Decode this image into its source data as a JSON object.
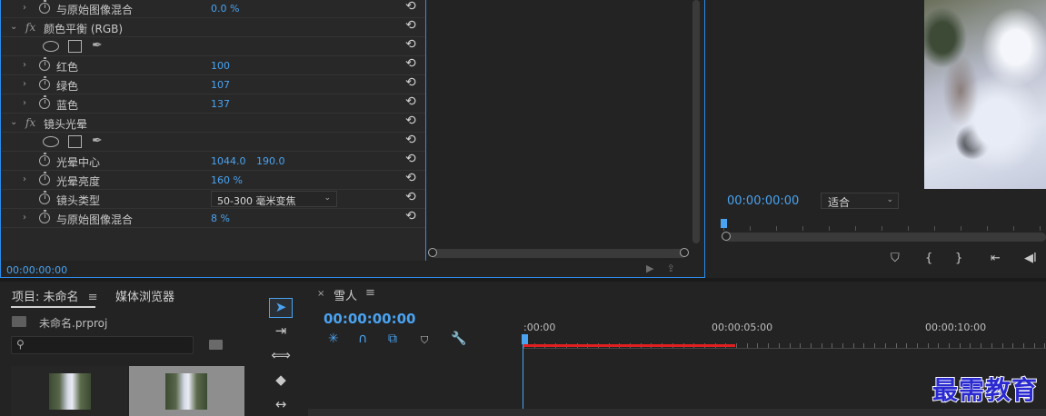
{
  "effect_controls": {
    "rows": [
      {
        "type": "param",
        "expand": true,
        "stopwatch": true,
        "label": "与原始图像混合",
        "value": "0.0 %"
      },
      {
        "type": "effect",
        "label": "颜色平衡 (RGB)"
      },
      {
        "type": "shapes"
      },
      {
        "type": "param",
        "expand": true,
        "stopwatch": true,
        "label": "红色",
        "value": "100"
      },
      {
        "type": "param",
        "expand": true,
        "stopwatch": true,
        "label": "绿色",
        "value": "107"
      },
      {
        "type": "param",
        "expand": true,
        "stopwatch": true,
        "label": "蓝色",
        "value": "137"
      },
      {
        "type": "effect",
        "label": "镜头光晕"
      },
      {
        "type": "shapes"
      },
      {
        "type": "param",
        "expand": false,
        "stopwatch": true,
        "label": "光晕中心",
        "value": "1044.0",
        "value2": "190.0"
      },
      {
        "type": "param",
        "expand": true,
        "stopwatch": true,
        "label": "光晕亮度",
        "value": "160 %"
      },
      {
        "type": "dropdown",
        "expand": false,
        "stopwatch": true,
        "label": "镜头类型",
        "value": "50-300 毫米变焦"
      },
      {
        "type": "param",
        "expand": true,
        "stopwatch": true,
        "label": "与原始图像混合",
        "value": "8 %"
      }
    ],
    "timecode": "00:00:00:00",
    "fx_symbol": "fx",
    "reset_glyph": "⟲"
  },
  "program_monitor": {
    "timecode": "00:00:00:00",
    "zoom": "适合",
    "controls": [
      "marker",
      "in-point",
      "out-point",
      "go-to-in",
      "step-back"
    ]
  },
  "project_panel": {
    "tab_project": "项目: 未命名",
    "tab_media": "媒体浏览器",
    "menu_glyph": "≡",
    "project_file": "未命名.prproj",
    "search_placeholder": ""
  },
  "sequence": {
    "title": "雪人",
    "menu_glyph": "≡",
    "close_glyph": "×",
    "timecode": "00:00:00:00",
    "ruler_labels": [
      ":00:00",
      "00:00:05:00",
      "00:00:10:00"
    ]
  },
  "watermark": "最需教育",
  "colors": {
    "accent": "#4aa3f0",
    "panel": "#232323",
    "red_bar": "#e02020"
  }
}
